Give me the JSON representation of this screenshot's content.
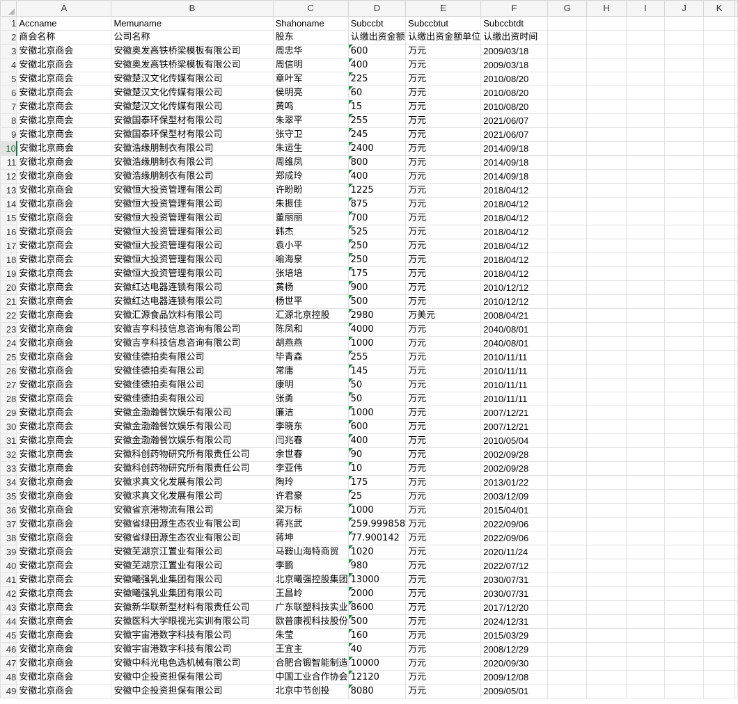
{
  "columns": [
    "A",
    "B",
    "C",
    "D",
    "E",
    "F",
    "G",
    "H",
    "I",
    "J",
    "K"
  ],
  "rows": [
    [
      "Accname",
      "Memuname",
      "Shahoname",
      "Subccbt",
      "Subccbtut",
      "Subccbtdt"
    ],
    [
      "商会名称",
      "公司名称",
      "股东",
      "认缴出资金额",
      "认缴出资金额单位",
      "认缴出资时间"
    ],
    [
      "安徽北京商会",
      "安徽奥发高铁桥梁模板有限公司",
      "周忠华",
      "600",
      "万元",
      "2009/03/18"
    ],
    [
      "安徽北京商会",
      "安徽奥发高铁桥梁模板有限公司",
      "周信明",
      "400",
      "万元",
      "2009/03/18"
    ],
    [
      "安徽北京商会",
      "安徽楚汉文化传媒有限公司",
      "章叶军",
      "225",
      "万元",
      "2010/08/20"
    ],
    [
      "安徽北京商会",
      "安徽楚汉文化传媒有限公司",
      "侯明亮",
      "60",
      "万元",
      "2010/08/20"
    ],
    [
      "安徽北京商会",
      "安徽楚汉文化传媒有限公司",
      "黄鸣",
      "15",
      "万元",
      "2010/08/20"
    ],
    [
      "安徽北京商会",
      "安徽国泰环保型材有限公司",
      "朱翠平",
      "255",
      "万元",
      "2021/06/07"
    ],
    [
      "安徽北京商会",
      "安徽国泰环保型材有限公司",
      "张守卫",
      "245",
      "万元",
      "2021/06/07"
    ],
    [
      "安徽北京商会",
      "安徽浩缘朋制衣有限公司",
      "朱运生",
      "2400",
      "万元",
      "2014/09/18"
    ],
    [
      "安徽北京商会",
      "安徽浩缘朋制衣有限公司",
      "周维凤",
      "800",
      "万元",
      "2014/09/18"
    ],
    [
      "安徽北京商会",
      "安徽浩缘朋制衣有限公司",
      "郑成玲",
      "400",
      "万元",
      "2014/09/18"
    ],
    [
      "安徽北京商会",
      "安徽恒大投资管理有限公司",
      "许盼盼",
      "1225",
      "万元",
      "2018/04/12"
    ],
    [
      "安徽北京商会",
      "安徽恒大投资管理有限公司",
      "朱振佳",
      "875",
      "万元",
      "2018/04/12"
    ],
    [
      "安徽北京商会",
      "安徽恒大投资管理有限公司",
      "董丽丽",
      "700",
      "万元",
      "2018/04/12"
    ],
    [
      "安徽北京商会",
      "安徽恒大投资管理有限公司",
      "韩杰",
      "525",
      "万元",
      "2018/04/12"
    ],
    [
      "安徽北京商会",
      "安徽恒大投资管理有限公司",
      "袁小平",
      "250",
      "万元",
      "2018/04/12"
    ],
    [
      "安徽北京商会",
      "安徽恒大投资管理有限公司",
      "喻海泉",
      "250",
      "万元",
      "2018/04/12"
    ],
    [
      "安徽北京商会",
      "安徽恒大投资管理有限公司",
      "张培培",
      "175",
      "万元",
      "2018/04/12"
    ],
    [
      "安徽北京商会",
      "安徽红达电器连锁有限公司",
      "黄杨",
      "900",
      "万元",
      "2010/12/12"
    ],
    [
      "安徽北京商会",
      "安徽红达电器连锁有限公司",
      "杨世平",
      "500",
      "万元",
      "2010/12/12"
    ],
    [
      "安徽北京商会",
      "安徽汇源食品饮料有限公司",
      "汇源北京控股",
      "2980",
      "万美元",
      "2008/04/21"
    ],
    [
      "安徽北京商会",
      "安徽吉亨科技信息咨询有限公司",
      "陈凤和",
      "4000",
      "万元",
      "2040/08/01"
    ],
    [
      "安徽北京商会",
      "安徽吉亨科技信息咨询有限公司",
      "胡燕燕",
      "1000",
      "万元",
      "2040/08/01"
    ],
    [
      "安徽北京商会",
      "安徽佳德拍卖有限公司",
      "毕青森",
      "255",
      "万元",
      "2010/11/11"
    ],
    [
      "安徽北京商会",
      "安徽佳德拍卖有限公司",
      "常庸",
      "145",
      "万元",
      "2010/11/11"
    ],
    [
      "安徽北京商会",
      "安徽佳德拍卖有限公司",
      "康明",
      "50",
      "万元",
      "2010/11/11"
    ],
    [
      "安徽北京商会",
      "安徽佳德拍卖有限公司",
      "张勇",
      "50",
      "万元",
      "2010/11/11"
    ],
    [
      "安徽北京商会",
      "安徽金渤瀚餐饮娱乐有限公司",
      "廉洁",
      "1000",
      "万元",
      "2007/12/21"
    ],
    [
      "安徽北京商会",
      "安徽金渤瀚餐饮娱乐有限公司",
      "李晓东",
      "600",
      "万元",
      "2007/12/21"
    ],
    [
      "安徽北京商会",
      "安徽金渤瀚餐饮娱乐有限公司",
      "闫兆春",
      "400",
      "万元",
      "2010/05/04"
    ],
    [
      "安徽北京商会",
      "安徽科创药物研究所有限责任公司",
      "余世春",
      "90",
      "万元",
      "2002/09/28"
    ],
    [
      "安徽北京商会",
      "安徽科创药物研究所有限责任公司",
      "李亚伟",
      "10",
      "万元",
      "2002/09/28"
    ],
    [
      "安徽北京商会",
      "安徽求真文化发展有限公司",
      "陶玲",
      "175",
      "万元",
      "2013/01/22"
    ],
    [
      "安徽北京商会",
      "安徽求真文化发展有限公司",
      "许君豪",
      "25",
      "万元",
      "2003/12/09"
    ],
    [
      "安徽北京商会",
      "安徽省京港物流有限公司",
      "梁万标",
      "1000",
      "万元",
      "2015/04/01"
    ],
    [
      "安徽北京商会",
      "安徽省绿田源生态农业有限公司",
      "蒋兆武",
      "259.999858",
      "万元",
      "2022/09/06"
    ],
    [
      "安徽北京商会",
      "安徽省绿田源生态农业有限公司",
      "蒋坤",
      "77.900142",
      "万元",
      "2022/09/06"
    ],
    [
      "安徽北京商会",
      "安徽芜湖京江置业有限公司",
      "马鞍山海特商贸",
      "1020",
      "万元",
      "2020/11/24"
    ],
    [
      "安徽北京商会",
      "安徽芜湖京江置业有限公司",
      "李鹏",
      "980",
      "万元",
      "2022/07/12"
    ],
    [
      "安徽北京商会",
      "安徽曦强乳业集团有限公司",
      "北京曦强控股集团",
      "13000",
      "万元",
      "2030/07/31"
    ],
    [
      "安徽北京商会",
      "安徽曦强乳业集团有限公司",
      "王昌岭",
      "2000",
      "万元",
      "2030/07/31"
    ],
    [
      "安徽北京商会",
      "安徽新华联新型材料有限责任公司",
      "广东联塑科技实业",
      "8600",
      "万元",
      "2017/12/20"
    ],
    [
      "安徽北京商会",
      "安徽医科大学眼视光实训有限公司",
      "欧普康视科技股份",
      "500",
      "万元",
      "2024/12/31"
    ],
    [
      "安徽北京商会",
      "安徽宇宙港数字科技有限公司",
      "朱莹",
      "160",
      "万元",
      "2015/03/29"
    ],
    [
      "安徽北京商会",
      "安徽宇宙港数字科技有限公司",
      "王宜主",
      "40",
      "万元",
      "2008/12/29"
    ],
    [
      "安徽北京商会",
      "安徽中科光电色选机械有限公司",
      "合肥合锻智能制造",
      "10000",
      "万元",
      "2020/09/30"
    ],
    [
      "安徽北京商会",
      "安徽中企投资担保有限公司",
      "中国工业合作协会",
      "12120",
      "万元",
      "2009/12/08"
    ],
    [
      "安徽北京商会",
      "安徽中企投资担保有限公司",
      "北京中节创投",
      "8080",
      "万元",
      "2009/05/01"
    ]
  ]
}
